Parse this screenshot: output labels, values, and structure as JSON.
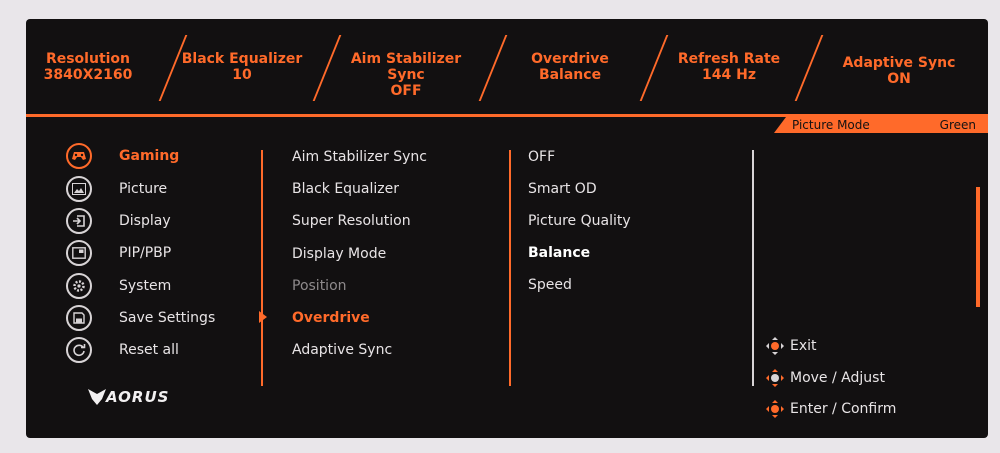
{
  "status_bar": [
    {
      "label": "Resolution",
      "value": "3840X2160"
    },
    {
      "label": "Black Equalizer",
      "value": "10"
    },
    {
      "label": "Aim Stabilizer Sync",
      "value": "OFF"
    },
    {
      "label": "Overdrive",
      "value": "Balance"
    },
    {
      "label": "Refresh Rate",
      "value": "144 Hz"
    },
    {
      "label": "Adaptive Sync",
      "value": "ON"
    }
  ],
  "picture_mode": {
    "label": "Picture Mode",
    "value": "Green"
  },
  "menu": [
    {
      "label": "Gaming",
      "icon": "gamepad-icon"
    },
    {
      "label": "Picture",
      "icon": "picture-icon"
    },
    {
      "label": "Display",
      "icon": "input-icon"
    },
    {
      "label": "PIP/PBP",
      "icon": "pip-icon"
    },
    {
      "label": "System",
      "icon": "gear-icon"
    },
    {
      "label": "Save Settings",
      "icon": "save-icon"
    },
    {
      "label": "Reset all",
      "icon": "reset-icon"
    }
  ],
  "gaming_settings": [
    "Aim Stabilizer Sync",
    "Black Equalizer",
    "Super Resolution",
    "Display Mode",
    "Position",
    "Overdrive",
    "Adaptive Sync"
  ],
  "overdrive_options": [
    "OFF",
    "Smart OD",
    "Picture Quality",
    "Balance",
    "Speed"
  ],
  "help": [
    {
      "action": "Exit",
      "extra": ""
    },
    {
      "action": "Move",
      "extra": "/ Adjust"
    },
    {
      "action": "Enter",
      "extra": "/ Confirm"
    }
  ],
  "brand": "AORUS",
  "colors": {
    "accent": "#ff6a2a",
    "background": "#121011",
    "text": "#e8e4e6"
  }
}
